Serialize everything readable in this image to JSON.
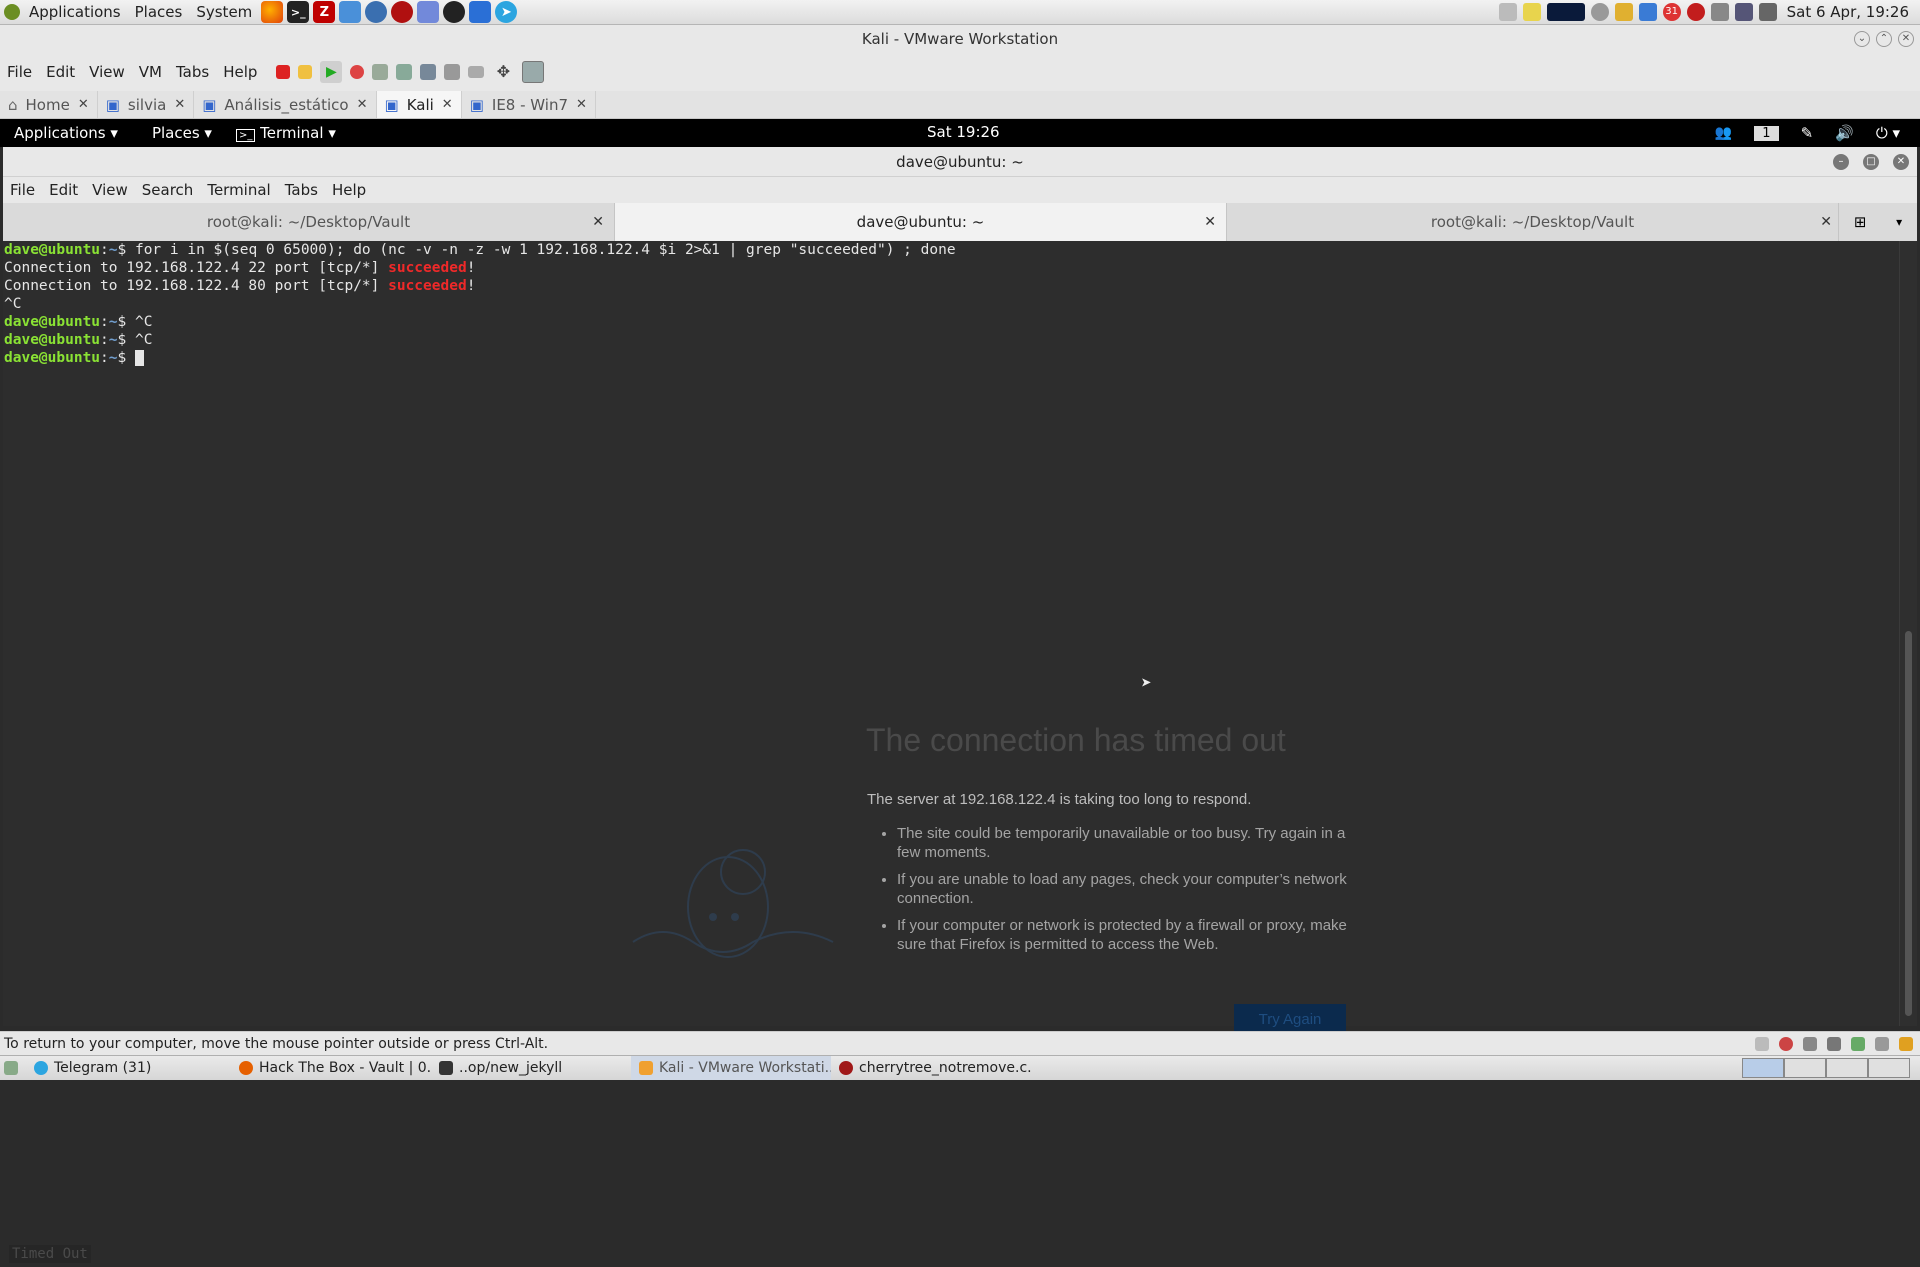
{
  "host_panel": {
    "menus": [
      "Applications",
      "Places",
      "System"
    ],
    "clock": "Sat  6 Apr, 19:26",
    "badge": "31"
  },
  "vmware": {
    "title": "Kali - VMware Workstation",
    "menus": [
      "File",
      "Edit",
      "View",
      "VM",
      "Tabs",
      "Help"
    ],
    "tabs": [
      {
        "label": "Home"
      },
      {
        "label": "silvia"
      },
      {
        "label": "Análisis_estático"
      },
      {
        "label": "Kali"
      },
      {
        "label": "IE8 - Win7"
      }
    ],
    "status_message": "To return to your computer, move the mouse pointer outside or press Ctrl-Alt."
  },
  "guest_panel": {
    "applications": "Applications",
    "places": "Places",
    "terminal": "Terminal",
    "clock": "Sat 19:26",
    "workspace": "1"
  },
  "terminal": {
    "title": "dave@ubuntu: ~",
    "menus": [
      "File",
      "Edit",
      "View",
      "Search",
      "Terminal",
      "Tabs",
      "Help"
    ],
    "tabs": [
      {
        "label": "root@kali: ~/Desktop/Vault"
      },
      {
        "label": "dave@ubuntu: ~"
      },
      {
        "label": "root@kali: ~/Desktop/Vault"
      }
    ],
    "prompt_user": "dave@ubuntu",
    "prompt_path": "~",
    "prompt_symbol": "$",
    "command": " for i in $(seq 0 65000); do (nc -v -n -z -w 1 192.168.122.4 $i 2>&1 | grep \"succeeded\") ; done",
    "output": [
      {
        "prefix": "Connection to 192.168.122.4 22 port [tcp/*] ",
        "highlight": "succeeded",
        "suffix": "!"
      },
      {
        "prefix": "Connection to 192.168.122.4 80 port [tcp/*] ",
        "highlight": "succeeded",
        "suffix": "!"
      }
    ],
    "interrupt": "^C",
    "line2_cmd": " ^C",
    "line3_cmd": " ^C",
    "line4_cmd": " "
  },
  "background_page": {
    "title": "The connection has timed out",
    "description": "The server at 192.168.122.4 is taking too long to respond.",
    "bullets": [
      "The site could be temporarily unavailable or too busy. Try again in a few moments.",
      "If you are unable to load any pages, check your computer’s network connection.",
      "If your computer or network is protected by a firewall or proxy, make sure that Firefox is permitted to access the Web."
    ],
    "button": "Try Again",
    "status": "Timed Out"
  },
  "host_taskbar": {
    "tasks": [
      {
        "label": "Telegram (31)",
        "color": "#2ca5e0"
      },
      {
        "label": "Hack The Box - Vault | 0...",
        "color": "#e66000"
      },
      {
        "label": "..op/new_jekyll",
        "color": "#333333"
      },
      {
        "label": "Kali - VMware Workstati...",
        "color": "#f0a030"
      },
      {
        "label": "cherrytree_notremove.c...",
        "color": "#a01818"
      }
    ]
  }
}
